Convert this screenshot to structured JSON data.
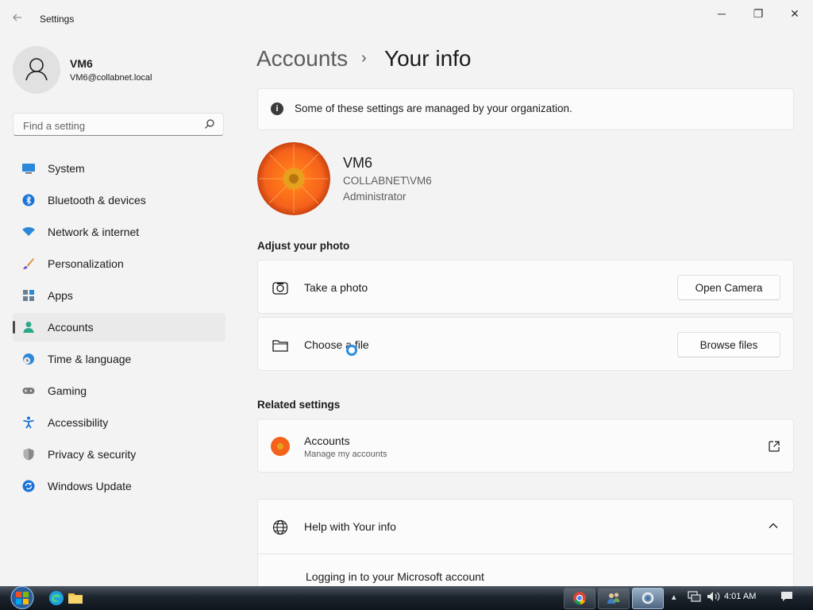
{
  "window": {
    "title": "Settings",
    "minimize_glyph": "─",
    "maximize_glyph": "❐",
    "close_glyph": "✕"
  },
  "profile": {
    "name": "VM6",
    "email": "VM6@collabnet.local"
  },
  "search": {
    "placeholder": "Find a setting"
  },
  "nav": {
    "items": [
      {
        "label": "System",
        "icon": "monitor-icon"
      },
      {
        "label": "Bluetooth & devices",
        "icon": "bluetooth-icon"
      },
      {
        "label": "Network & internet",
        "icon": "wifi-icon"
      },
      {
        "label": "Personalization",
        "icon": "brush-icon"
      },
      {
        "label": "Apps",
        "icon": "apps-icon"
      },
      {
        "label": "Accounts",
        "icon": "person-icon",
        "selected": true
      },
      {
        "label": "Time & language",
        "icon": "globe-clock-icon"
      },
      {
        "label": "Gaming",
        "icon": "gamepad-icon"
      },
      {
        "label": "Accessibility",
        "icon": "accessibility-icon"
      },
      {
        "label": "Privacy & security",
        "icon": "shield-icon"
      },
      {
        "label": "Windows Update",
        "icon": "update-icon"
      }
    ]
  },
  "header": {
    "parent": "Accounts",
    "separator": "›",
    "current": "Your info"
  },
  "info_bar": {
    "icon_glyph": "i",
    "text": "Some of these settings are managed by your organization."
  },
  "user": {
    "name": "VM6",
    "domain": "COLLABNET\\VM6",
    "role": "Administrator"
  },
  "adjust_photo": {
    "heading": "Adjust your photo",
    "take_photo_label": "Take a photo",
    "open_camera_button": "Open Camera",
    "choose_file_label": "Choose a file",
    "browse_button": "Browse files"
  },
  "related": {
    "heading": "Related settings",
    "accounts_title": "Accounts",
    "accounts_subtitle": "Manage my accounts"
  },
  "help": {
    "title": "Help with Your info",
    "link": "Logging in to your Microsoft account"
  },
  "taskbar": {
    "clock": "4:01 AM"
  },
  "colors": {
    "accent": "#0067c0",
    "background": "#f3f3f3",
    "card": "#fbfbfb"
  }
}
